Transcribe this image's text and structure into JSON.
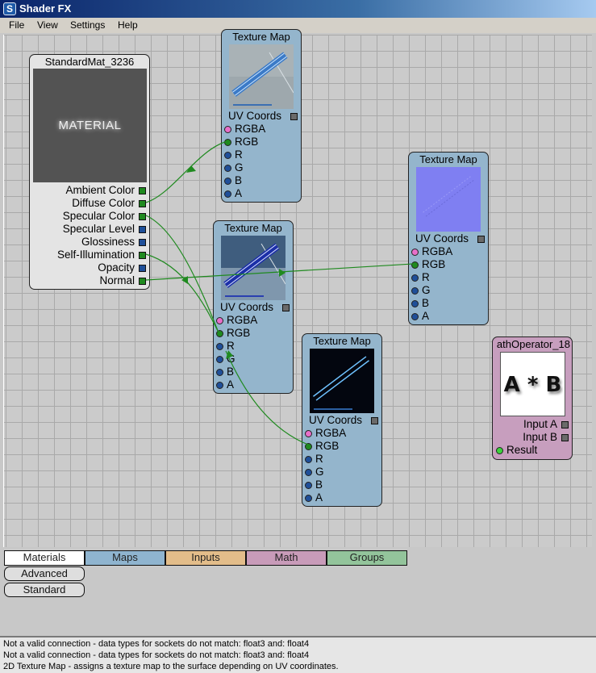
{
  "window": {
    "title": "Shader FX",
    "icon": "app-logo-icon"
  },
  "menu": [
    "File",
    "View",
    "Settings",
    "Help"
  ],
  "colors": {
    "wire": "#1f8a1f",
    "maps_node": "#94b5cc",
    "math_node": "#c79ebe",
    "materials_tab": "#ffffff",
    "maps_tab": "#8fb4cf",
    "inputs_tab": "#e3bd8a",
    "math_tab": "#c89bb9",
    "groups_tab": "#93c49b"
  },
  "material_node": {
    "title": "StandardMat_3236",
    "preview_label": "MATERIAL",
    "ports": [
      {
        "label": "Ambient Color",
        "type": "float3"
      },
      {
        "label": "Diffuse Color",
        "type": "float3"
      },
      {
        "label": "Specular Color",
        "type": "float3"
      },
      {
        "label": "Specular Level",
        "type": "float"
      },
      {
        "label": "Glossiness",
        "type": "float"
      },
      {
        "label": "Self-Illumination",
        "type": "float3"
      },
      {
        "label": "Opacity",
        "type": "float"
      },
      {
        "label": "Normal",
        "type": "float3"
      }
    ]
  },
  "texture_nodes": [
    {
      "title": "Texture Map",
      "preview": "metal-diffuse",
      "input": "UV Coords",
      "outputs": [
        "RGBA",
        "RGB",
        "R",
        "G",
        "B",
        "A"
      ]
    },
    {
      "title": "Texture Map",
      "preview": "metal-dark",
      "input": "UV Coords",
      "outputs": [
        "RGBA",
        "RGB",
        "R",
        "G",
        "B",
        "A"
      ]
    },
    {
      "title": "Texture Map",
      "preview": "normal-map",
      "input": "UV Coords",
      "outputs": [
        "RGBA",
        "RGB",
        "R",
        "G",
        "B",
        "A"
      ]
    },
    {
      "title": "Texture Map",
      "preview": "glow-lines",
      "input": "UV Coords",
      "outputs": [
        "RGBA",
        "RGB",
        "R",
        "G",
        "B",
        "A"
      ]
    }
  ],
  "math_node": {
    "title": "athOperator_18",
    "preview_label": "A * B",
    "inputs": [
      "Input A",
      "Input B"
    ],
    "output": "Result"
  },
  "palette": {
    "tabs": [
      "Materials",
      "Maps",
      "Inputs",
      "Math",
      "Groups"
    ],
    "active_tab": "Materials",
    "items": [
      "Advanced",
      "Standard"
    ]
  },
  "status": [
    "Not a valid connection - data types for sockets do not match: float3 and: float4",
    "Not a valid connection - data types for sockets do not match: float3 and: float4",
    "2D Texture Map - assigns a texture map to the surface depending on UV coordinates."
  ]
}
